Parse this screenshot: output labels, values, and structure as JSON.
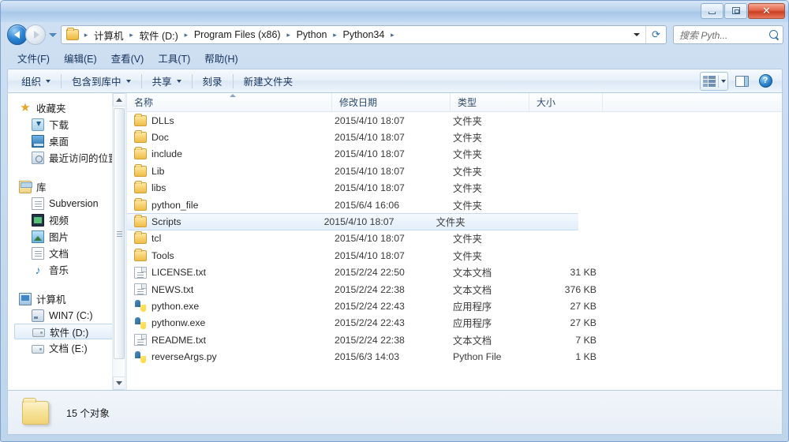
{
  "window": {
    "controls": {
      "minimize": "minimize",
      "restore": "restore",
      "close": "close"
    }
  },
  "address": {
    "folder_icon": "folder-icon",
    "crumbs": [
      "计算机",
      "软件 (D:)",
      "Program Files (x86)",
      "Python",
      "Python34"
    ],
    "separator": "▸",
    "dropdown_icon": "chevron-down-icon",
    "refresh_icon": "refresh-icon",
    "back_icon": "back-arrow-icon",
    "forward_icon": "forward-arrow-icon",
    "history_icon": "history-dropdown-icon"
  },
  "search": {
    "placeholder": "搜索 Pyth...",
    "icon": "search-icon"
  },
  "menubar": {
    "items": [
      {
        "label": "文件(F)",
        "name": "menu-file"
      },
      {
        "label": "编辑(E)",
        "name": "menu-edit"
      },
      {
        "label": "查看(V)",
        "name": "menu-view"
      },
      {
        "label": "工具(T)",
        "name": "menu-tools"
      },
      {
        "label": "帮助(H)",
        "name": "menu-help"
      }
    ]
  },
  "toolbar": {
    "organize": "组织",
    "include_in_library": "包含到库中",
    "share": "共享",
    "burn": "刻录",
    "new_folder": "新建文件夹",
    "view_icon": "view-options-icon",
    "view_caret": "chevron-down-icon",
    "preview_pane_icon": "preview-pane-icon",
    "help_icon": "help-icon",
    "help_glyph": "?"
  },
  "sidebar": {
    "favorites": {
      "label": "收藏夹",
      "icon": "star-icon",
      "items": [
        {
          "label": "下载",
          "icon": "downloads-icon"
        },
        {
          "label": "桌面",
          "icon": "desktop-icon"
        },
        {
          "label": "最近访问的位置",
          "icon": "recent-places-icon"
        }
      ]
    },
    "libraries": {
      "label": "库",
      "icon": "library-icon",
      "items": [
        {
          "label": "Subversion",
          "icon": "document-icon"
        },
        {
          "label": "视频",
          "icon": "video-icon"
        },
        {
          "label": "图片",
          "icon": "pictures-icon"
        },
        {
          "label": "文档",
          "icon": "documents-icon"
        },
        {
          "label": "音乐",
          "icon": "music-icon"
        }
      ]
    },
    "computer": {
      "label": "计算机",
      "icon": "computer-icon",
      "items": [
        {
          "label": "WIN7 (C:)",
          "icon": "hard-drive-icon",
          "selected": false
        },
        {
          "label": "软件 (D:)",
          "icon": "drive-icon",
          "selected": true
        },
        {
          "label": "文档 (E:)",
          "icon": "drive-icon",
          "selected": false
        }
      ]
    },
    "scrollbar": {
      "up_icon": "scroll-up-icon",
      "down_icon": "scroll-down-icon",
      "thumb": "scrollbar-thumb"
    }
  },
  "filelist": {
    "columns": [
      {
        "label": "名称",
        "key": "name",
        "sorted": "asc"
      },
      {
        "label": "修改日期",
        "key": "date"
      },
      {
        "label": "类型",
        "key": "type"
      },
      {
        "label": "大小",
        "key": "size"
      }
    ],
    "rows": [
      {
        "name": "DLLs",
        "date": "2015/4/10 18:07",
        "type": "文件夹",
        "size": "",
        "icon": "folder-icon",
        "selected": false
      },
      {
        "name": "Doc",
        "date": "2015/4/10 18:07",
        "type": "文件夹",
        "size": "",
        "icon": "folder-icon",
        "selected": false
      },
      {
        "name": "include",
        "date": "2015/4/10 18:07",
        "type": "文件夹",
        "size": "",
        "icon": "folder-icon",
        "selected": false
      },
      {
        "name": "Lib",
        "date": "2015/4/10 18:07",
        "type": "文件夹",
        "size": "",
        "icon": "folder-icon",
        "selected": false
      },
      {
        "name": "libs",
        "date": "2015/4/10 18:07",
        "type": "文件夹",
        "size": "",
        "icon": "folder-icon",
        "selected": false
      },
      {
        "name": "python_file",
        "date": "2015/6/4 16:06",
        "type": "文件夹",
        "size": "",
        "icon": "folder-icon",
        "selected": false
      },
      {
        "name": "Scripts",
        "date": "2015/4/10 18:07",
        "type": "文件夹",
        "size": "",
        "icon": "folder-icon",
        "selected": true
      },
      {
        "name": "tcl",
        "date": "2015/4/10 18:07",
        "type": "文件夹",
        "size": "",
        "icon": "folder-icon",
        "selected": false
      },
      {
        "name": "Tools",
        "date": "2015/4/10 18:07",
        "type": "文件夹",
        "size": "",
        "icon": "folder-icon",
        "selected": false
      },
      {
        "name": "LICENSE.txt",
        "date": "2015/2/24 22:50",
        "type": "文本文档",
        "size": "31 KB",
        "icon": "text-file-icon",
        "selected": false
      },
      {
        "name": "NEWS.txt",
        "date": "2015/2/24 22:38",
        "type": "文本文档",
        "size": "376 KB",
        "icon": "text-file-icon",
        "selected": false
      },
      {
        "name": "python.exe",
        "date": "2015/2/24 22:43",
        "type": "应用程序",
        "size": "27 KB",
        "icon": "python-exe-icon",
        "selected": false
      },
      {
        "name": "pythonw.exe",
        "date": "2015/2/24 22:43",
        "type": "应用程序",
        "size": "27 KB",
        "icon": "python-exe-icon",
        "selected": false
      },
      {
        "name": "README.txt",
        "date": "2015/2/24 22:38",
        "type": "文本文档",
        "size": "7 KB",
        "icon": "text-file-icon",
        "selected": false
      },
      {
        "name": "reverseArgs.py",
        "date": "2015/6/3 14:03",
        "type": "Python File",
        "size": "1 KB",
        "icon": "python-file-icon",
        "selected": false
      }
    ]
  },
  "statusbar": {
    "text": "15 个对象",
    "icon": "folder-large-icon"
  },
  "colors": {
    "accent": "#2d86d6",
    "selection": "#e2eefa",
    "selection_border": "#c6dcf1",
    "folder_yellow": "#f0d377",
    "close_red": "#c93e22",
    "frame": "#b5cbe1"
  }
}
